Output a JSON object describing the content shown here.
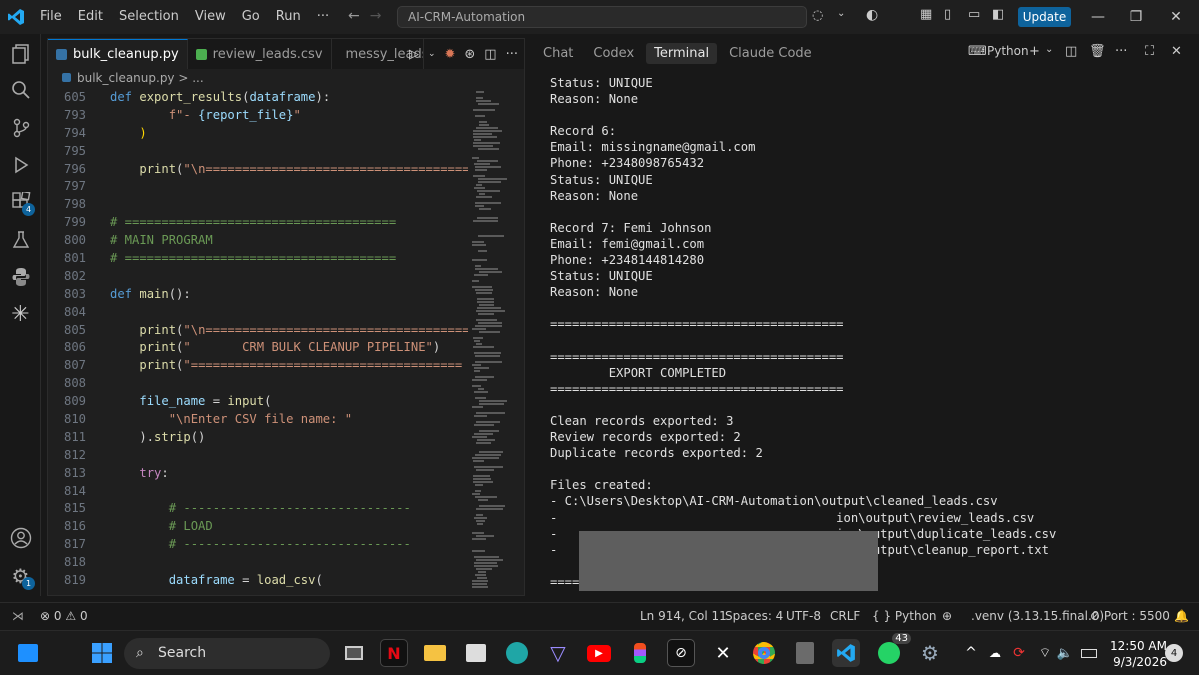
{
  "titlebar": {
    "menu": [
      "File",
      "Edit",
      "Selection",
      "View",
      "Go",
      "Run",
      "···"
    ],
    "search": "AI-CRM-Automation",
    "update_label": "Update"
  },
  "activity_badges": {
    "extensions": "4",
    "settings": "1"
  },
  "editor": {
    "tabs": [
      {
        "label": "bulk_cleanup.py",
        "color": "#3572A5"
      },
      {
        "label": "review_leads.csv",
        "color": "#4caf50"
      },
      {
        "label": "messy_leads.",
        "color": "#4caf50"
      }
    ],
    "breadcrumb": "bulk_cleanup.py > ..."
  },
  "code_lines": [
    {
      "n": "605",
      "t": "def export_results(dataframe):"
    },
    {
      "n": "793",
      "t": "        f\"- {report_file}\""
    },
    {
      "n": "794",
      "t": "    )"
    },
    {
      "n": "795",
      "t": ""
    },
    {
      "n": "796",
      "t": "    print(\"\\n=====================================\")"
    },
    {
      "n": "797",
      "t": ""
    },
    {
      "n": "798",
      "t": ""
    },
    {
      "n": "799",
      "t": "# ====================================="
    },
    {
      "n": "800",
      "t": "# MAIN PROGRAM"
    },
    {
      "n": "801",
      "t": "# ====================================="
    },
    {
      "n": "802",
      "t": ""
    },
    {
      "n": "803",
      "t": "def main():"
    },
    {
      "n": "804",
      "t": ""
    },
    {
      "n": "805",
      "t": "    print(\"\\n=====================================\")"
    },
    {
      "n": "806",
      "t": "    print(\"       CRM BULK CLEANUP PIPELINE\")"
    },
    {
      "n": "807",
      "t": "    print(\"=====================================\")"
    },
    {
      "n": "808",
      "t": ""
    },
    {
      "n": "809",
      "t": "    file_name = input("
    },
    {
      "n": "810",
      "t": "        \"\\nEnter CSV file name: \""
    },
    {
      "n": "811",
      "t": "    ).strip()"
    },
    {
      "n": "812",
      "t": ""
    },
    {
      "n": "813",
      "t": "    try:"
    },
    {
      "n": "814",
      "t": ""
    },
    {
      "n": "815",
      "t": "        # -------------------------------"
    },
    {
      "n": "816",
      "t": "        # LOAD"
    },
    {
      "n": "817",
      "t": "        # -------------------------------"
    },
    {
      "n": "818",
      "t": ""
    },
    {
      "n": "819",
      "t": "        dataframe = load_csv("
    }
  ],
  "panel": {
    "tabs": [
      "Chat",
      "Codex",
      "Terminal",
      "Claude Code"
    ],
    "active_tab": "Terminal",
    "shell": "Python"
  },
  "terminal_lines": [
    "Status: UNIQUE",
    "Reason: None",
    "",
    "Record 6:",
    "Email: missingname@gmail.com",
    "Phone: +2348098765432",
    "Status: UNIQUE",
    "Reason: None",
    "",
    "Record 7: Femi Johnson",
    "Email: femi@gmail.com",
    "Phone: +2348144814280",
    "Status: UNIQUE",
    "Reason: None",
    "",
    "========================================",
    "",
    "========================================",
    "        EXPORT COMPLETED",
    "========================================",
    "",
    "Clean records exported: 3",
    "Review records exported: 2",
    "Duplicate records exported: 2",
    "",
    "Files created:",
    "- C:\\Users\\Desktop\\AI-CRM-Automation\\output\\cleaned_leads.csv",
    "-                                      ion\\output\\review_leads.csv",
    "-                                      ion\\output\\duplicate_leads.csv",
    "-                                      ion\\output\\cleanup_report.txt",
    "",
    "========================================"
  ],
  "statusbar": {
    "errors": "0",
    "warnings": "0",
    "position": "Ln 914, Col 11",
    "spaces": "Spaces: 4",
    "encoding": "UTF-8",
    "eol": "CRLF",
    "language": "Python",
    "venv": ".venv (3.13.15.final.0)",
    "port": "Port : 5500"
  },
  "taskbar": {
    "search": "Search",
    "time": "12:50 AM",
    "date": "9/3/2026",
    "notif_count": "4",
    "whatsapp_badge": "43"
  }
}
